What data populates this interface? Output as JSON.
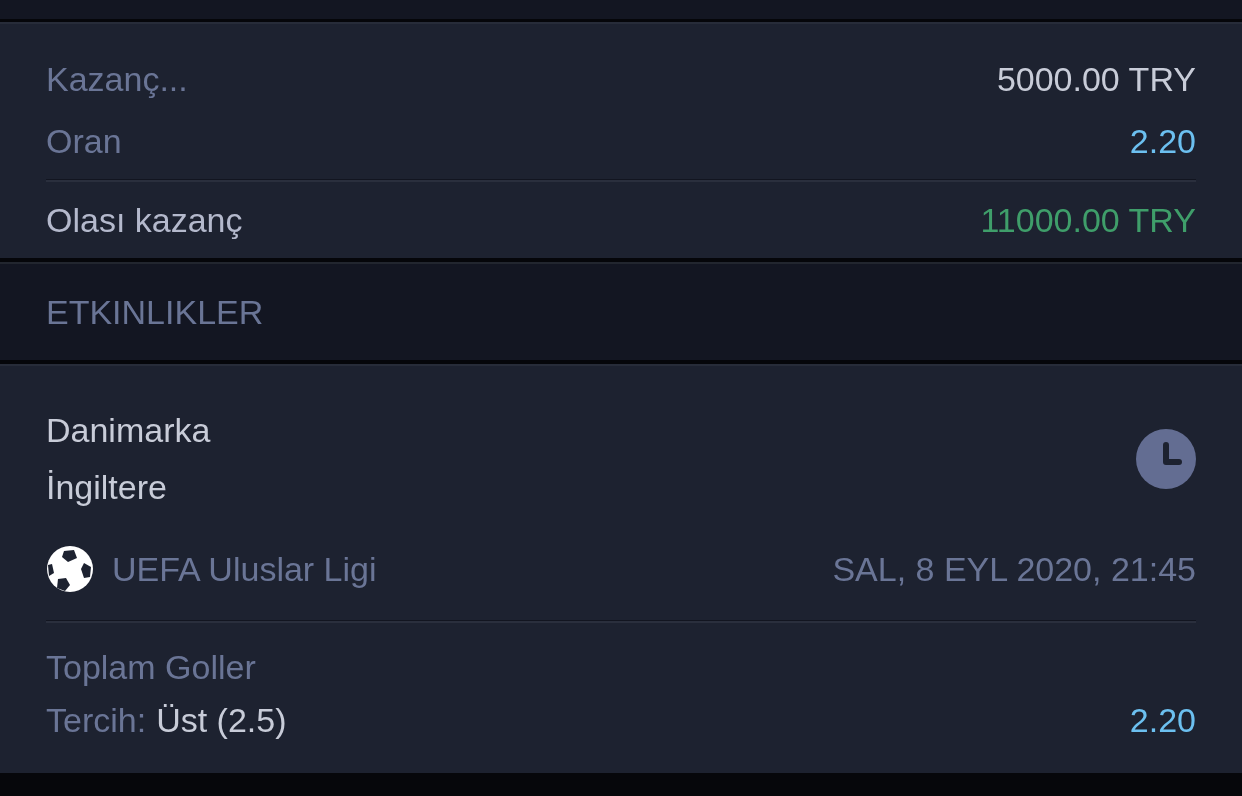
{
  "summary": {
    "stake": {
      "label": "Kazanç...",
      "value": "5000.00 TRY"
    },
    "odds": {
      "label": "Oran",
      "value": "2.20"
    },
    "potential_win": {
      "label": "Olası kazanç",
      "value": "11000.00 TRY"
    }
  },
  "events_header": "ETKINLIKLER",
  "events": [
    {
      "home": "Danimarka",
      "away": "İngiltere",
      "league": "UEFA Uluslar Ligi",
      "datetime": "SAL, 8 EYL 2020, 21:45",
      "market": "Toplam Goller",
      "pick_label": "Tercih:",
      "pick": "Üst (2.5)",
      "odds": "2.20"
    }
  ]
}
